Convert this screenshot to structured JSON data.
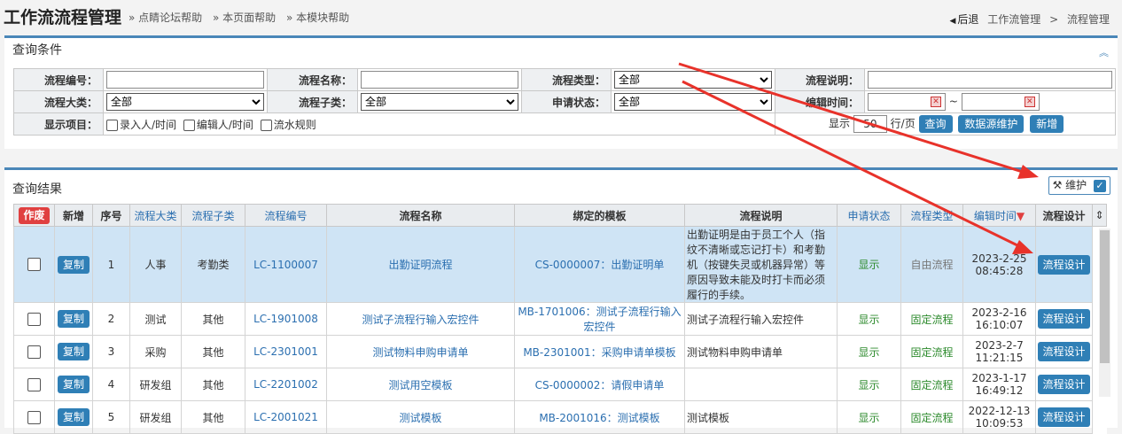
{
  "header": {
    "title": "工作流流程管理",
    "help_links": [
      "» 点睛论坛帮助",
      "» 本页面帮助",
      "» 本模块帮助"
    ],
    "back_label": "后退",
    "breadcrumb": [
      "工作流管理",
      "流程管理"
    ],
    "breadcrumb_sep": ">"
  },
  "query": {
    "title": "查询条件",
    "labels": {
      "code": "流程编号：",
      "name": "流程名称：",
      "type": "流程类型：",
      "desc": "流程说明：",
      "category": "流程大类：",
      "subcategory": "流程子类：",
      "apply_status": "申请状态：",
      "edit_time": "编辑时间：",
      "display_items": "显示项目："
    },
    "values": {
      "type": "全部",
      "category": "全部",
      "subcategory": "全部",
      "apply_status": "全部",
      "date_sep": "~"
    },
    "display_options": [
      "录入人/时间",
      "编辑人/时间",
      "流水规则"
    ],
    "show_label": "显示",
    "rows_value": "50",
    "rows_unit": "行/页",
    "buttons": {
      "search": "查询",
      "datasource": "数据源维护",
      "add": "新增"
    }
  },
  "results": {
    "title": "查询结果",
    "maintain_label": "维护",
    "columns": [
      "作废",
      "新增",
      "序号",
      "流程大类",
      "流程子类",
      "流程编号",
      "流程名称",
      "绑定的模板",
      "流程说明",
      "申请状态",
      "流程类型",
      "编辑时间",
      "流程设计"
    ],
    "sort_marker": "▼",
    "copy_label": "复制",
    "design_label": "流程设计",
    "rows": [
      {
        "no": "1",
        "category": "人事",
        "sub": "考勤类",
        "code": "LC-1100007",
        "name": "出勤证明流程",
        "template": "CS-0000007：出勤证明单",
        "desc": "出勤证明是由于员工个人（指纹不清晰或忘记打卡）和考勤机（按键失灵或机器异常）等原因导致未能及时打卡而必须履行的手续。",
        "status": "显示",
        "type": "自由流程",
        "date": "2023-2-25",
        "time": "08:45:28"
      },
      {
        "no": "2",
        "category": "测试",
        "sub": "其他",
        "code": "LC-1901008",
        "name": "测试子流程行输入宏控件",
        "template": "MB-1701006：测试子流程行输入宏控件",
        "desc": "测试子流程行输入宏控件",
        "status": "显示",
        "type": "固定流程",
        "date": "2023-2-16",
        "time": "16:10:07"
      },
      {
        "no": "3",
        "category": "采购",
        "sub": "其他",
        "code": "LC-2301001",
        "name": "测试物料申购申请单",
        "template": "MB-2301001：采购申请单模板",
        "desc": "测试物料申购申请单",
        "status": "显示",
        "type": "固定流程",
        "date": "2023-2-7",
        "time": "11:21:15"
      },
      {
        "no": "4",
        "category": "研发组",
        "sub": "其他",
        "code": "LC-2201002",
        "name": "测试用空模板",
        "template": "CS-0000002：请假申请单",
        "desc": "",
        "status": "显示",
        "type": "固定流程",
        "date": "2023-1-17",
        "time": "16:49:12"
      },
      {
        "no": "5",
        "category": "研发组",
        "sub": "其他",
        "code": "LC-2001021",
        "name": "测试模板",
        "template": "MB-2001016：测试模板",
        "desc": "测试模板",
        "status": "显示",
        "type": "固定流程",
        "date": "2022-12-13",
        "time": "10:09:53"
      }
    ]
  }
}
